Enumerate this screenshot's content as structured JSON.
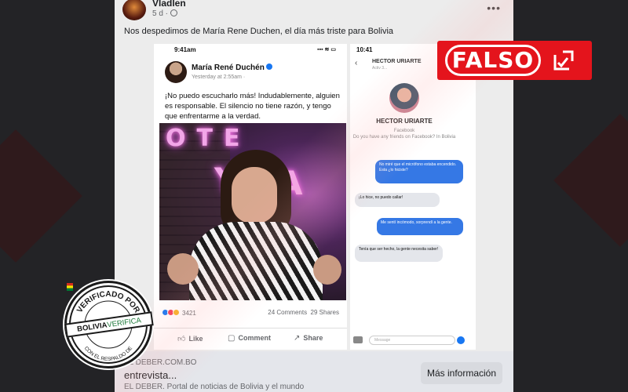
{
  "post": {
    "author": "Vladlen",
    "meta": "5 d ·",
    "text": "Nos despedimos de María Rene Duchen, el día más triste para Bolivia"
  },
  "screenshot": {
    "status_time": "9:41am",
    "status_icons": "▪▪▪ ≋ ▭",
    "fb_name": "María René Duchén",
    "fb_time": "Yesterday at 2:55am ·",
    "fb_text": "¡No puedo escucharlo más! Indudablemente, alguien es responsable. El silencio no tiene razón, y tengo que enfrentarme a la verdad.",
    "photo_sign_1": "OTE",
    "photo_sign_2": "A",
    "photo_sign_3": "Y",
    "reaction_count": "3421",
    "comments": "24 Comments",
    "shares": "29 Shares",
    "actions": {
      "like": "Like",
      "comment": "Comment",
      "share": "Share"
    }
  },
  "messenger": {
    "status_time": "10:41",
    "contact_name": "HECTOR URIARTE",
    "contact_sub": "Activ 3...",
    "profile_name": "HECTOR URIARTE",
    "profile_sub": "Facebook\nDo you have any friends on Facebook? In Bolivia",
    "messages": [
      "No miré que el micrófono estaba encendido. Esta ¿lo hiciste?",
      "¡Lo hice, no puedo callar!",
      "Me sentí incómodo, sorprendí a la gente.",
      "Tenía que ser hecho, la gente necesita saber!"
    ],
    "input_placeholder": "Message"
  },
  "link_preview": {
    "domain": "EL DEBER.COM.BO",
    "title": "entrevista...",
    "description": "EL DEBER. Portal de noticias de Bolivia y el mundo",
    "button": "Más información"
  },
  "stamp": {
    "label": "FALSO"
  },
  "seal": {
    "top_text": "VERIFICADO POR",
    "bottom_text": "CON EL RESPALDO DE",
    "brand_bolivia": "BOLIVIA",
    "brand_verifica": "VERIFICA"
  },
  "colors": {
    "stamp_red": "#e4141c",
    "messenger_blue": "#3578e5",
    "facebook_blue": "#1877f2",
    "verifica_green": "#1d7a3a"
  },
  "icons": [
    "more-icon",
    "globe-icon",
    "verified-icon",
    "like-icon",
    "comment-icon",
    "share-icon",
    "back-icon",
    "camera-icon",
    "send-icon",
    "falso-check-icon",
    "seal-flag-icon"
  ]
}
